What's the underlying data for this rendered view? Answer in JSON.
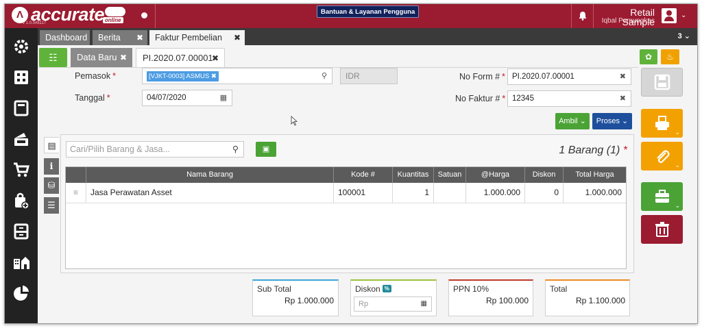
{
  "header": {
    "logo_text": "accurate",
    "logo_online": "online",
    "version": "v 1.0.0#8117",
    "help_button": "Bantuan & Layanan Pengguna",
    "company": "Retail Sample",
    "username": "Iqbal Pamungkas",
    "brand_color": "#9b1b30"
  },
  "tabs": [
    {
      "label": "Dashboard"
    },
    {
      "label": "Berita"
    },
    {
      "label": "Faktur Pembelian"
    }
  ],
  "tab_count": "3",
  "subtabs": {
    "new_data": "Data Baru",
    "document": "PI.2020.07.00001"
  },
  "form": {
    "supplier_label": "Pemasok",
    "supplier_value": "[VJKT-0003] ASMUS",
    "currency": "IDR",
    "date_label": "Tanggal",
    "date_value": "04/07/2020",
    "form_no_label": "No Form #",
    "form_no_value": "PI.2020.07.00001",
    "invoice_no_label": "No Faktur #",
    "invoice_no_value": "12345",
    "required_mark": "*"
  },
  "buttons": {
    "ambil": "Ambil",
    "proses": "Proses"
  },
  "detail": {
    "search_placeholder": "Cari/Pilih Barang & Jasa...",
    "item_count": "1 Barang (1)",
    "columns": [
      "Nama Barang",
      "Kode #",
      "Kuantitas",
      "Satuan",
      "@Harga",
      "Diskon",
      "Total Harga"
    ],
    "rows": [
      {
        "name": "Jasa Perawatan Asset",
        "code": "100001",
        "qty": "1",
        "unit": "",
        "price": "1.000.000",
        "discount": "0",
        "total": "1.000.000"
      }
    ]
  },
  "summary": {
    "subtotal_label": "Sub Total",
    "subtotal_value": "Rp 1.000.000",
    "discount_label": "Diskon",
    "discount_badge": "%",
    "discount_placeholder": "Rp",
    "ppn_label": "PPN 10%",
    "ppn_value": "Rp 100.000",
    "total_label": "Total",
    "total_value": "Rp 1.100.000"
  },
  "icons": {
    "sidebar": [
      "settings-icon",
      "grid-icon",
      "book-icon",
      "wallet-icon",
      "cart-icon",
      "bag-add-icon",
      "archive-icon",
      "building-icon",
      "pie-chart-icon"
    ],
    "actions": [
      "save-icon",
      "print-icon",
      "attachment-icon",
      "briefcase-icon",
      "trash-icon"
    ]
  }
}
